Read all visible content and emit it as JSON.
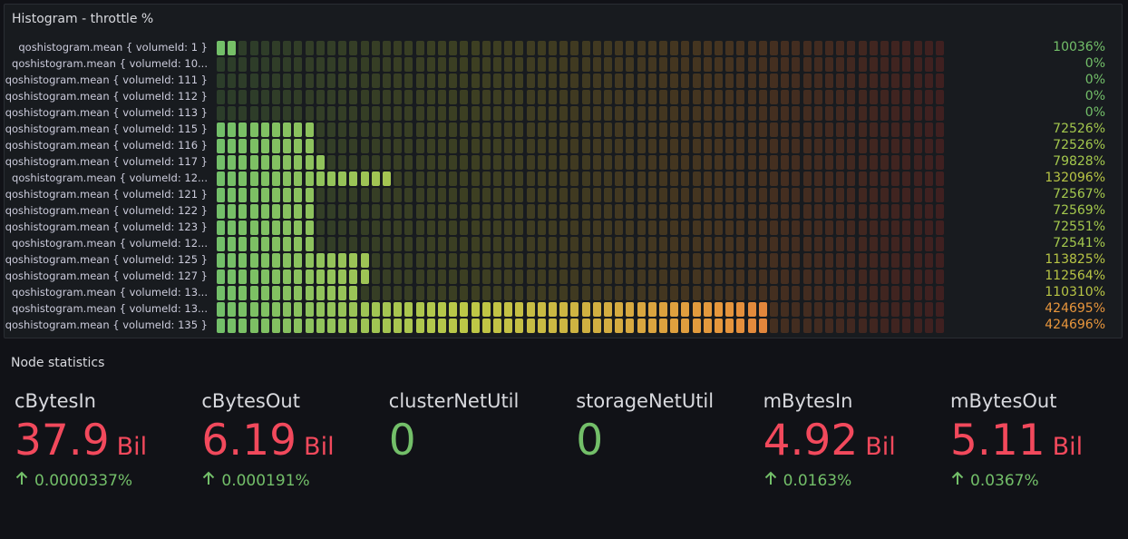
{
  "histogram": {
    "title": "Histogram - throttle %",
    "total_cells": 66,
    "rows": [
      {
        "label": "qoshistogram.mean { volumeId: 1 }",
        "value": "10036%",
        "filled": 2,
        "color": "#73bf69"
      },
      {
        "label": "qoshistogram.mean { volumeId: 10...",
        "value": "0%",
        "filled": 0,
        "color": "#73bf69"
      },
      {
        "label": "qoshistogram.mean { volumeId: 111 }",
        "value": "0%",
        "filled": 0,
        "color": "#73bf69"
      },
      {
        "label": "qoshistogram.mean { volumeId: 112 }",
        "value": "0%",
        "filled": 0,
        "color": "#73bf69"
      },
      {
        "label": "qoshistogram.mean { volumeId: 113 }",
        "value": "0%",
        "filled": 0,
        "color": "#73bf69"
      },
      {
        "label": "qoshistogram.mean { volumeId: 115 }",
        "value": "72526%",
        "filled": 9,
        "color": "#a4c84d"
      },
      {
        "label": "qoshistogram.mean { volumeId: 116 }",
        "value": "72526%",
        "filled": 9,
        "color": "#a4c84d"
      },
      {
        "label": "qoshistogram.mean { volumeId: 117 }",
        "value": "79828%",
        "filled": 10,
        "color": "#a4c84d"
      },
      {
        "label": "qoshistogram.mean { volumeId: 12...",
        "value": "132096%",
        "filled": 16,
        "color": "#b8c545"
      },
      {
        "label": "qoshistogram.mean { volumeId: 121 }",
        "value": "72567%",
        "filled": 9,
        "color": "#a4c84d"
      },
      {
        "label": "qoshistogram.mean { volumeId: 122 }",
        "value": "72569%",
        "filled": 9,
        "color": "#a4c84d"
      },
      {
        "label": "qoshistogram.mean { volumeId: 123 }",
        "value": "72551%",
        "filled": 9,
        "color": "#a4c84d"
      },
      {
        "label": "qoshistogram.mean { volumeId: 12...",
        "value": "72541%",
        "filled": 9,
        "color": "#a4c84d"
      },
      {
        "label": "qoshistogram.mean { volumeId: 125 }",
        "value": "113825%",
        "filled": 14,
        "color": "#b8c545"
      },
      {
        "label": "qoshistogram.mean { volumeId: 127 }",
        "value": "112564%",
        "filled": 14,
        "color": "#b8c545"
      },
      {
        "label": "qoshistogram.mean { volumeId: 13...",
        "value": "110310%",
        "filled": 13,
        "color": "#b8c545"
      },
      {
        "label": "qoshistogram.mean { volumeId: 13...",
        "value": "424695%",
        "filled": 50,
        "color": "#e8963c"
      },
      {
        "label": "qoshistogram.mean { volumeId: 135 }",
        "value": "424696%",
        "filled": 50,
        "color": "#e8963c"
      }
    ]
  },
  "node_statistics": {
    "title": "Node statistics",
    "stats": [
      {
        "name": "cBytesIn",
        "value": "37.9",
        "unit": "Bil",
        "change": "0.0000337%",
        "color": "#f2495c"
      },
      {
        "name": "cBytesOut",
        "value": "6.19",
        "unit": "Bil",
        "change": "0.000191%",
        "color": "#f2495c"
      },
      {
        "name": "clusterNetUtil",
        "value": "0",
        "unit": "",
        "change": "",
        "color": "#73bf69"
      },
      {
        "name": "storageNetUtil",
        "value": "0",
        "unit": "",
        "change": "",
        "color": "#73bf69"
      },
      {
        "name": "mBytesIn",
        "value": "4.92",
        "unit": "Bil",
        "change": "0.0163%",
        "color": "#f2495c"
      },
      {
        "name": "mBytesOut",
        "value": "5.11",
        "unit": "Bil",
        "change": "0.0367%",
        "color": "#f2495c"
      }
    ],
    "change_icon": "arrow-up-icon"
  }
}
